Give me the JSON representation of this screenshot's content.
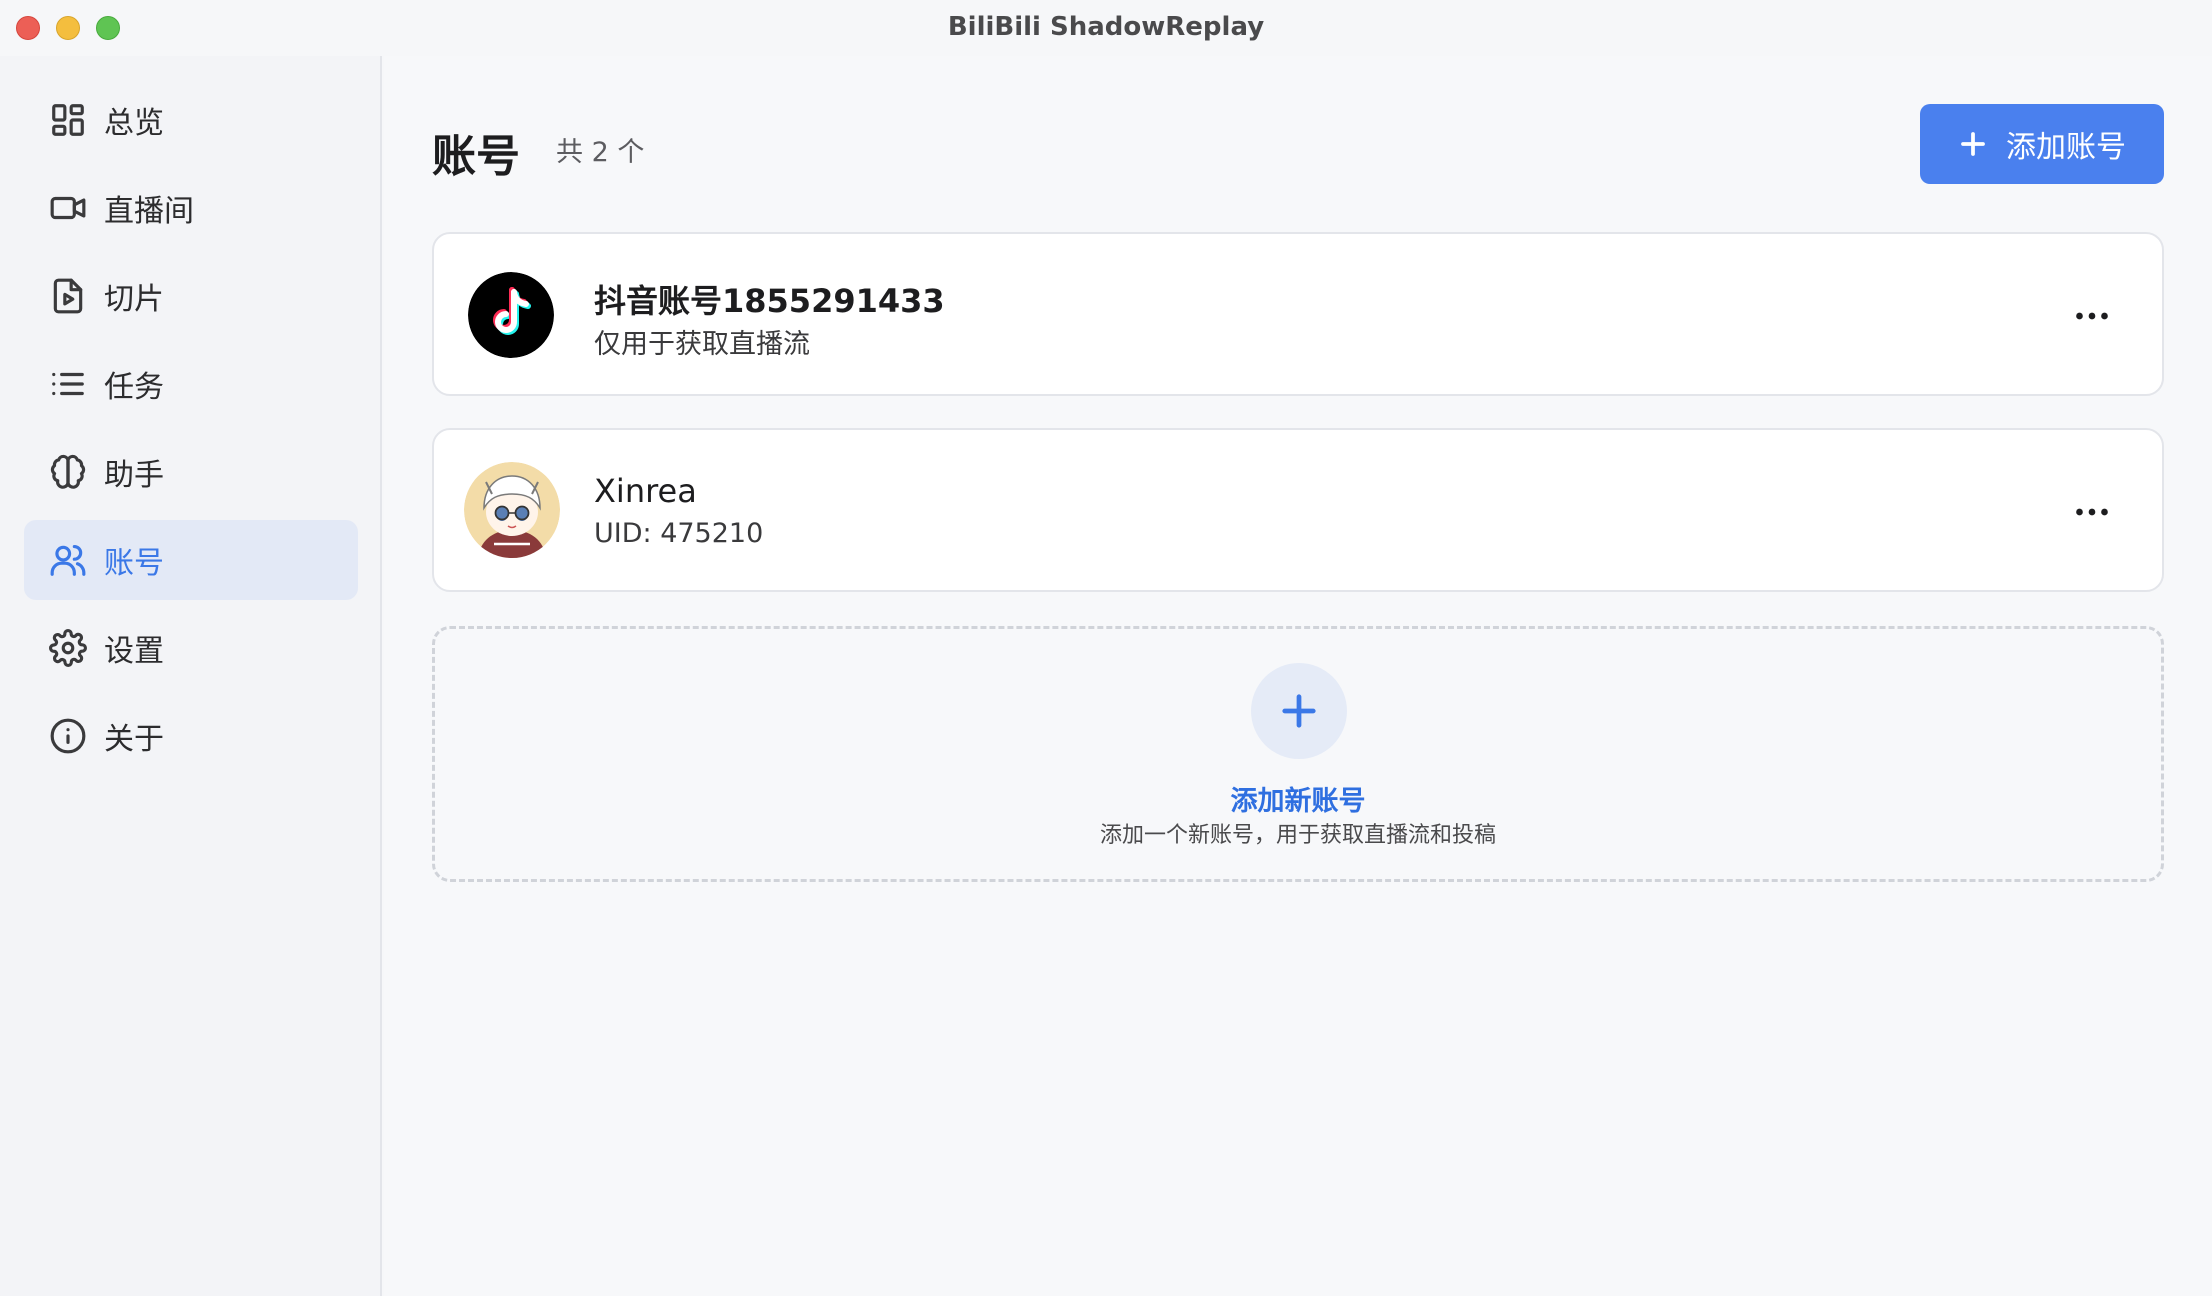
{
  "window": {
    "title": "BiliBili ShadowReplay"
  },
  "sidebar": {
    "items": [
      {
        "label": "总览",
        "icon": "dashboard-icon",
        "active": false
      },
      {
        "label": "直播间",
        "icon": "video-camera-icon",
        "active": false
      },
      {
        "label": "切片",
        "icon": "video-file-icon",
        "active": false
      },
      {
        "label": "任务",
        "icon": "list-icon",
        "active": false
      },
      {
        "label": "助手",
        "icon": "brain-icon",
        "active": false
      },
      {
        "label": "账号",
        "icon": "users-icon",
        "active": true
      },
      {
        "label": "设置",
        "icon": "gear-icon",
        "active": false
      },
      {
        "label": "关于",
        "icon": "info-icon",
        "active": false
      }
    ]
  },
  "header": {
    "title": "账号",
    "count": "共 2 个",
    "add_button_label": "添加账号"
  },
  "accounts": [
    {
      "name": "抖音账号1855291433",
      "subtitle": "仅用于获取直播流",
      "avatar": "tiktok-logo-icon"
    },
    {
      "name": "Xinrea",
      "subtitle": "UID: 475210",
      "avatar": "anime-avatar-icon"
    }
  ],
  "add_card": {
    "title": "添加新账号",
    "description": "添加一个新账号，用于获取直播流和投稿"
  },
  "colors": {
    "accent": "#4a80ee",
    "active_bg": "#e3e9f6",
    "active_text": "#3b78e7"
  }
}
